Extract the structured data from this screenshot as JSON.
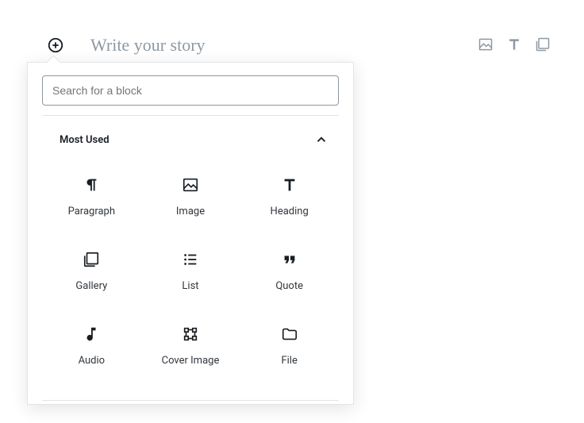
{
  "editor": {
    "placeholder": "Write your story"
  },
  "popover": {
    "search_placeholder": "Search for a block",
    "section_title": "Most Used",
    "blocks": {
      "paragraph": "Paragraph",
      "image": "Image",
      "heading": "Heading",
      "gallery": "Gallery",
      "list": "List",
      "quote": "Quote",
      "audio": "Audio",
      "cover_image": "Cover Image",
      "file": "File"
    }
  }
}
